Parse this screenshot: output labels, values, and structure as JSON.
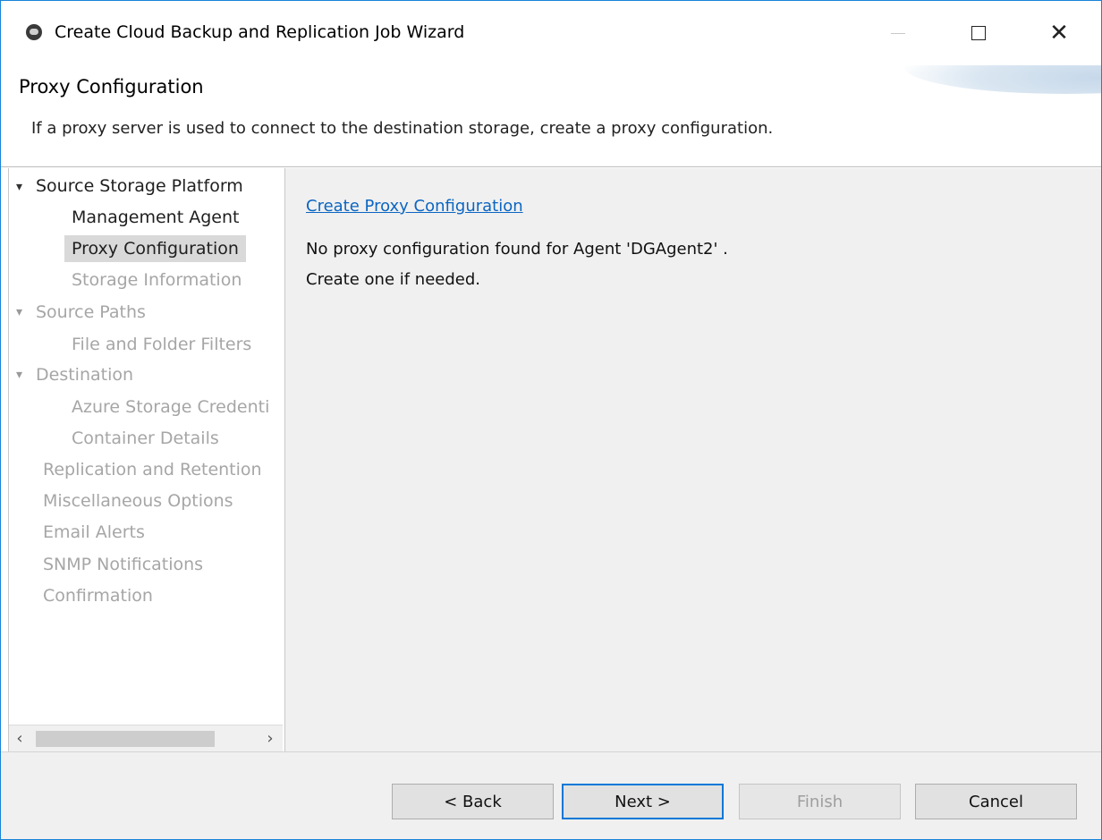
{
  "window": {
    "title": "Create Cloud Backup and Replication Job Wizard",
    "minimize_label": "—",
    "maximize_label": "□",
    "close_label": "✕"
  },
  "header": {
    "title": "Proxy Configuration",
    "description": "If a proxy server is used to connect to the destination storage, create a proxy configuration."
  },
  "nav": {
    "items": [
      {
        "label": "Source Storage Platform",
        "state": "enabled",
        "expandable": true
      },
      {
        "label": "Management Agent",
        "state": "enabled"
      },
      {
        "label": "Proxy Configuration",
        "state": "selected"
      },
      {
        "label": "Storage Information",
        "state": "disabled"
      },
      {
        "label": "Source Paths",
        "state": "disabled",
        "expandable": true
      },
      {
        "label": "File and Folder Filters",
        "state": "disabled"
      },
      {
        "label": "Destination",
        "state": "disabled",
        "expandable": true
      },
      {
        "label": "Azure Storage Credenti",
        "state": "disabled"
      },
      {
        "label": "Container Details",
        "state": "disabled"
      },
      {
        "label": "Replication and Retention",
        "state": "disabled"
      },
      {
        "label": "Miscellaneous Options",
        "state": "disabled"
      },
      {
        "label": "Email Alerts",
        "state": "disabled"
      },
      {
        "label": "SNMP Notifications",
        "state": "disabled"
      },
      {
        "label": "Confirmation",
        "state": "disabled"
      }
    ]
  },
  "content": {
    "link": "Create Proxy Configuration",
    "message_1": "No proxy configuration found for Agent 'DGAgent2' .",
    "message_2": "Create one if needed."
  },
  "footer": {
    "back": "< Back",
    "next": "Next >",
    "finish": "Finish",
    "cancel": "Cancel"
  },
  "colors": {
    "link": "#0b66c2",
    "selection": "#d9d9d9",
    "accent": "#0078d7"
  }
}
